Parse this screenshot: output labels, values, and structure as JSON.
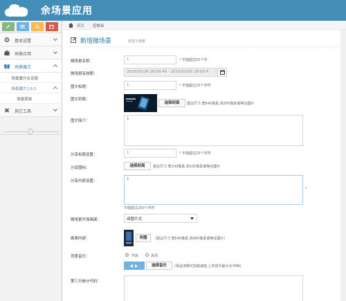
{
  "app": {
    "title": "余场景应用"
  },
  "shortcuts": [
    {
      "name": "edit",
      "color": "#87b87f"
    },
    {
      "name": "list",
      "color": "#6fb3e0"
    },
    {
      "name": "users",
      "color": "#ffb752"
    },
    {
      "name": "trash",
      "color": "#d15b47"
    }
  ],
  "sidebar": {
    "items": [
      {
        "label": "基本设置",
        "icon": "gear-icon"
      },
      {
        "label": "场景应用",
        "icon": "briefcase-icon"
      },
      {
        "label": "场景魔方",
        "icon": "gift-icon"
      }
    ],
    "sub_items": [
      {
        "label": "场景魔方合设版"
      },
      {
        "label": "场景魔方1,6,5"
      }
    ],
    "sub_sub_items": [
      {
        "label": "场景菜单"
      }
    ],
    "items2": [
      {
        "label": "其它工具",
        "icon": "tools-icon"
      }
    ],
    "collapse_symbol": "«"
  },
  "breadcrumb": {
    "home": "首页",
    "sep": "›",
    "current": "控制台"
  },
  "page": {
    "title": "新增微场景",
    "subtitle": "自定义场景"
  },
  "form": {
    "name_label": "微场景名称：",
    "name_value": "1",
    "name_hint": "不能超过50个字",
    "period_label": "微场景有效期：",
    "period_value": "2015/02/26 18:00:40 - 2015/03/05 18:00:4",
    "pic_title_label": "图文标题：",
    "pic_title_value": "1",
    "pic_title_hint": "不能超过25个字符",
    "cover_label": "图文封面：",
    "cover_button": "选择封面",
    "cover_hint": "建议尺寸:宽640像素,高300像素或等比图片",
    "intro_label": "图文简介：",
    "intro_value": "1",
    "share_title_label": "分享标题设置：",
    "share_title_value": "1",
    "share_title_hint": "不能超过25个字符",
    "share_icon_label": "分享图标：",
    "share_icon_button": "选择封面",
    "share_icon_hint": "建议尺寸:宽100像素,高100像素或等比图片",
    "share_content_label": "分享内容设置：",
    "share_content_value": "1",
    "share_content_hint": "不能超过200个字符",
    "open_label": "微场景开场画面：",
    "open_value": "阅图片式",
    "image_label": "画面内容：",
    "upload_button": "传图",
    "image_hint": "（建议尺寸:宽640像素,高960像素或等比图片）",
    "music_label": "背景音乐：",
    "music_on": "开启",
    "music_off": "关闭",
    "music_button": "选择音乐",
    "music_hint": "(保证流畅可加载速度,上传音乐最大为3MB)",
    "stats_label": "第三方统计代码："
  },
  "colors": {
    "topbar": "#438eb9",
    "link": "#4c8fbd"
  }
}
